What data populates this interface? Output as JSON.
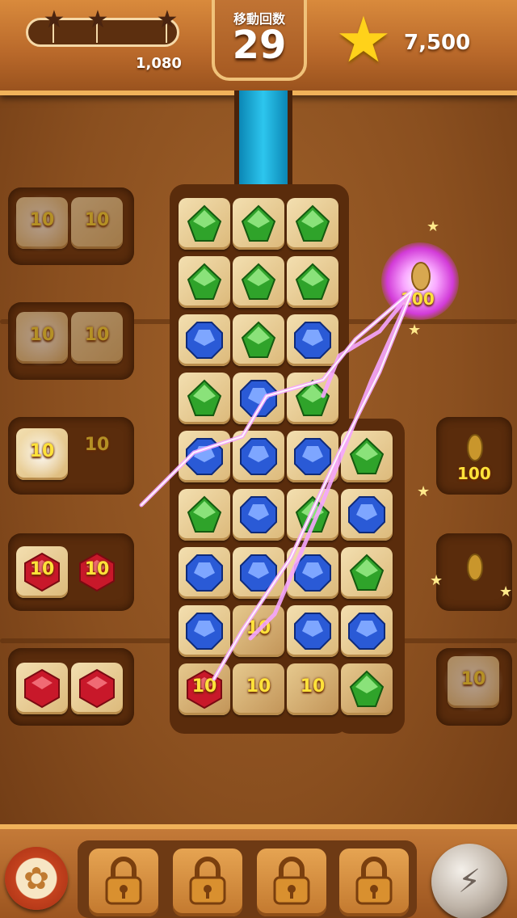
{
  "header": {
    "progress_score": "1,080",
    "moves_label": "移動回数",
    "moves_value": "29",
    "total_score": "7,500",
    "progress_stars": [
      "star-icon",
      "star-icon",
      "star-icon"
    ]
  },
  "coins": {
    "ten": "10",
    "hundred": "100"
  },
  "board": {
    "gem_colors": {
      "green": "#2fa32a",
      "blue": "#2a5ad6",
      "red": "#c8182a"
    }
  },
  "footer": {
    "settings_icon": "gear-icon",
    "locked_slots": [
      "lock-icon",
      "lock-icon",
      "lock-icon",
      "lock-icon"
    ],
    "booster_icon": "bomb-lightning-icon"
  }
}
